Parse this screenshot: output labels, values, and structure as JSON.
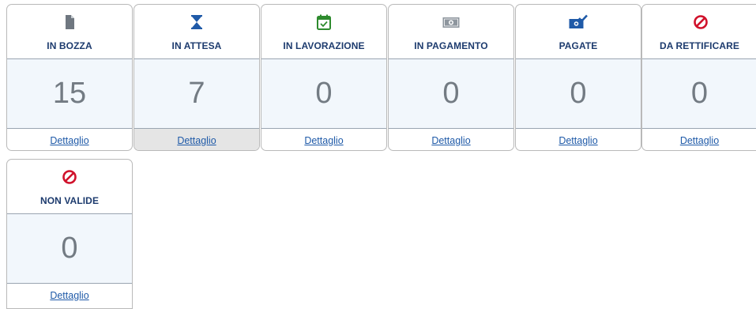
{
  "cards": [
    {
      "label": "IN BOZZA",
      "count": "15",
      "link": "Dettaglio",
      "icon": "document-icon",
      "color": "#6f7780",
      "active": false
    },
    {
      "label": "IN ATTESA",
      "count": "7",
      "link": "Dettaglio",
      "icon": "hourglass-icon",
      "color": "#1f5aa8",
      "active": true
    },
    {
      "label": "IN LAVORAZIONE",
      "count": "0",
      "link": "Dettaglio",
      "icon": "calendar-check-icon",
      "color": "#2e8b2e",
      "active": false
    },
    {
      "label": "IN PAGAMENTO",
      "count": "0",
      "link": "Dettaglio",
      "icon": "banknote-icon",
      "color": "#8e969e",
      "active": false
    },
    {
      "label": "PAGATE",
      "count": "0",
      "link": "Dettaglio",
      "icon": "banknote-check-icon",
      "color": "#1f5aa8",
      "active": false
    },
    {
      "label": "DA RETTIFICARE",
      "count": "0",
      "link": "Dettaglio",
      "icon": "prohibited-icon",
      "color": "#d0112b",
      "active": false
    },
    {
      "label": "NON VALIDE",
      "count": "0",
      "link": "Dettaglio",
      "icon": "prohibited-icon",
      "color": "#d0112b",
      "active": false
    }
  ]
}
